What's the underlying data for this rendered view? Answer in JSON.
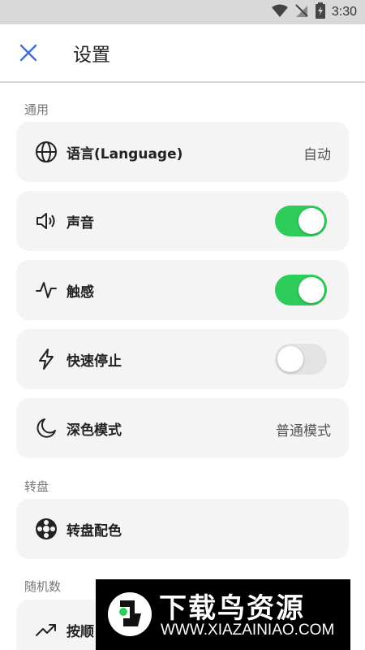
{
  "status_bar": {
    "time": "3:30"
  },
  "header": {
    "title": "设置"
  },
  "sections": {
    "general": "通用",
    "wheel": "转盘",
    "random": "随机数"
  },
  "items": {
    "language": {
      "label": "语言(Language)",
      "value": "自动"
    },
    "sound": {
      "label": "声音",
      "toggle": true
    },
    "haptics": {
      "label": "触感",
      "toggle": true
    },
    "quick_stop": {
      "label": "快速停止",
      "toggle": false
    },
    "dark_mode": {
      "label": "深色模式",
      "value": "普通模式"
    },
    "wheel_colors": {
      "label": "转盘配色"
    },
    "in_order": {
      "label": "按顺"
    }
  },
  "watermark": {
    "title": "下载鸟资源",
    "url": "WWW.XIAZAINIAO.COM"
  },
  "colors": {
    "accent": "#2ecc5a",
    "close_icon": "#3d6fd6",
    "card_bg": "#f4f4f4"
  }
}
